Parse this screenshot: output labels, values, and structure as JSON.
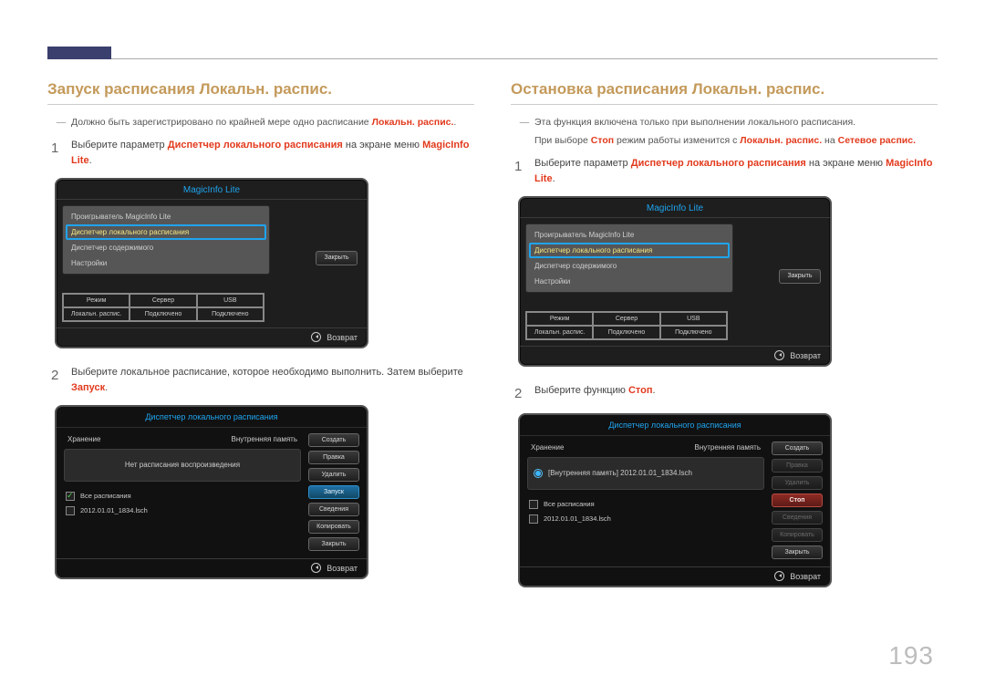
{
  "page_number": "193",
  "left": {
    "heading": "Запуск расписания Локальн. распис.",
    "note": {
      "text_pre": "Должно быть зарегистрировано по крайней мере одно расписание ",
      "hl": "Локальн. распис."
    },
    "step1": {
      "pre": "Выберите параметр ",
      "hl": "Диспетчер локального расписания",
      "mid": " на экране меню ",
      "hl2": "MagicInfo Lite",
      "post": "."
    },
    "step2": {
      "pre": "Выберите локальное расписание, которое необходимо выполнить. Затем выберите ",
      "hl": "Запуск",
      "post": "."
    },
    "panel1": {
      "title": "MagicInfo Lite",
      "items": [
        "Проигрыватель MagicInfo Lite",
        "Диспетчер локального расписания",
        "Диспетчер содержимого",
        "Настройки"
      ],
      "close": "Закрыть",
      "grid": {
        "r1": [
          "Режим",
          "Сервер",
          "USB"
        ],
        "r2": [
          "Локальн. распис.",
          "Подключено",
          "Подключено"
        ]
      },
      "ret": "Возврат"
    },
    "panel2": {
      "title": "Диспетчер локального расписания",
      "storage_label": "Хранение",
      "storage_val": "Внутренняя память",
      "content_msg": "Нет расписания воспроизведения",
      "chk_all": "Все расписания",
      "chk_item": "2012.01.01_1834.lsch",
      "buttons": [
        "Создать",
        "Правка",
        "Удалить",
        "Запуск",
        "Сведения",
        "Копировать",
        "Закрыть"
      ],
      "ret": "Возврат"
    }
  },
  "right": {
    "heading": "Остановка расписания Локальн. распис.",
    "note1": "Эта функция включена только при выполнении локального расписания.",
    "note2": {
      "pre": "При выборе ",
      "hl": "Стоп",
      "mid": " режим работы изменится с ",
      "hl2": "Локальн. распис.",
      "mid2": " на ",
      "hl3": "Сетевое распис."
    },
    "step1": {
      "pre": "Выберите параметр ",
      "hl": "Диспетчер локального расписания",
      "mid": " на экране меню ",
      "hl2": "MagicInfo Lite",
      "post": "."
    },
    "step2": {
      "pre": "Выберите функцию ",
      "hl": "Стоп",
      "post": "."
    },
    "panel1": {
      "title": "MagicInfo Lite",
      "items": [
        "Проигрыватель MagicInfo Lite",
        "Диспетчер локального расписания",
        "Диспетчер содержимого",
        "Настройки"
      ],
      "close": "Закрыть",
      "grid": {
        "r1": [
          "Режим",
          "Сервер",
          "USB"
        ],
        "r2": [
          "Локальн. распис.",
          "Подключено",
          "Подключено"
        ]
      },
      "ret": "Возврат"
    },
    "panel2": {
      "title": "Диспетчер локального расписания",
      "storage_label": "Хранение",
      "storage_val": "Внутренняя память",
      "content_msg": "[Внутренняя память] 2012.01.01_1834.lsch",
      "chk_all": "Все расписания",
      "chk_item": "2012.01.01_1834.lsch",
      "buttons": [
        "Создать",
        "Правка",
        "Удалить",
        "Стоп",
        "Сведения",
        "Копировать",
        "Закрыть"
      ],
      "ret": "Возврат"
    }
  }
}
